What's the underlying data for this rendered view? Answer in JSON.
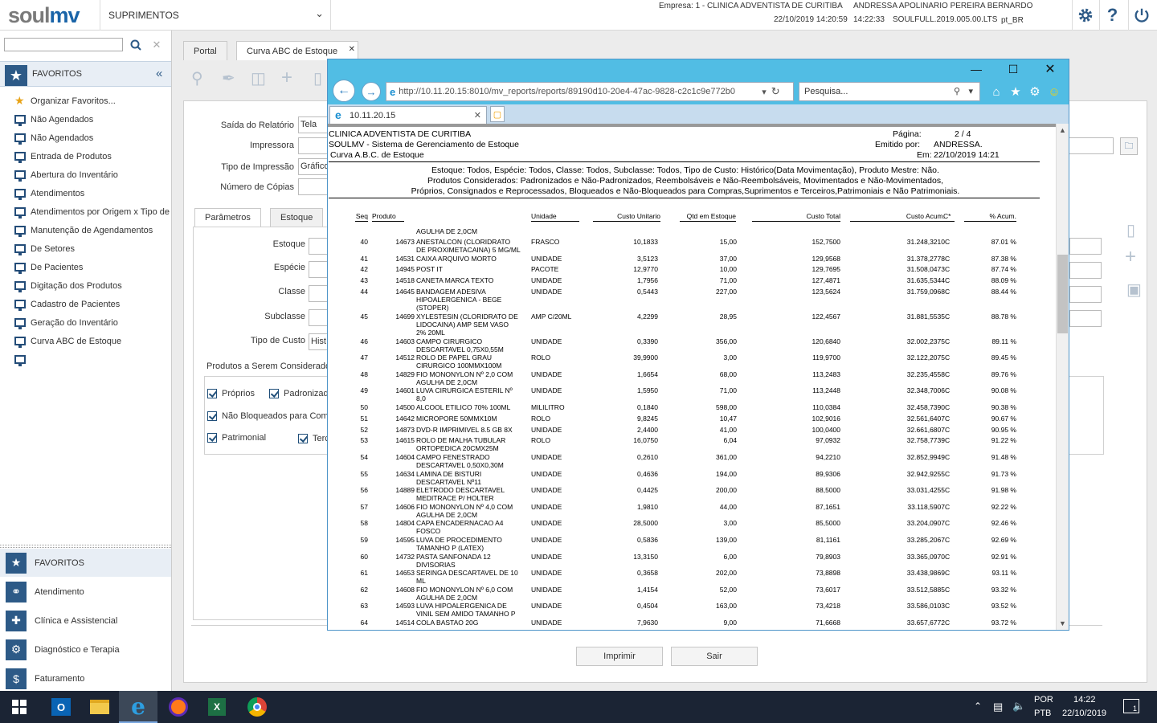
{
  "topbar": {
    "logo_main": "soul",
    "logo_accent": "mv",
    "module": "SUPRIMENTOS",
    "empresa": "Empresa: 1 - CLINICA ADVENTISTA DE CURITIBA",
    "user": "ANDRESSA APOLINARIO PEREIRA BERNARDO",
    "login_time": "22/10/2019 14:20:59",
    "clock": "14:22:33",
    "version": "SOULFULL.2019.005.00.LTS",
    "locale": "pt_BR",
    "icons": [
      "gear-icon",
      "help-icon",
      "power-icon"
    ]
  },
  "sidebar": {
    "search_placeholder": "",
    "favorites_title": "FAVORITOS",
    "items": [
      {
        "label": "Organizar Favoritos...",
        "icon": "star-icon"
      },
      {
        "label": "Não Agendados",
        "icon": "monitor-icon"
      },
      {
        "label": "Não Agendados",
        "icon": "monitor-icon"
      },
      {
        "label": "Entrada de Produtos",
        "icon": "monitor-icon"
      },
      {
        "label": "Abertura do Inventário",
        "icon": "monitor-icon"
      },
      {
        "label": "Atendimentos",
        "icon": "monitor-icon"
      },
      {
        "label": "Atendimentos por Origem x Tipo de",
        "icon": "monitor-icon"
      },
      {
        "label": "Manutenção de Agendamentos",
        "icon": "monitor-icon"
      },
      {
        "label": "De Setores",
        "icon": "monitor-icon"
      },
      {
        "label": "De Pacientes",
        "icon": "monitor-icon"
      },
      {
        "label": "Digitação dos Produtos",
        "icon": "monitor-icon"
      },
      {
        "label": "Cadastro de Pacientes",
        "icon": "monitor-icon"
      },
      {
        "label": "Geração do Inventário",
        "icon": "monitor-icon"
      },
      {
        "label": "Curva ABC de Estoque",
        "icon": "monitor-icon"
      },
      {
        "label": "",
        "icon": "monitor-icon"
      }
    ],
    "categories": [
      {
        "label": "FAVORITOS",
        "icon": "star-icon"
      },
      {
        "label": "Atendimento",
        "icon": "stethoscope-icon"
      },
      {
        "label": "Clínica e Assistencial",
        "icon": "medkit-icon"
      },
      {
        "label": "Diagnóstico e Terapia",
        "icon": "microscope-icon"
      },
      {
        "label": "Faturamento",
        "icon": "dollar-icon"
      }
    ]
  },
  "main": {
    "tabs": [
      {
        "label": "Portal"
      },
      {
        "label": "Curva ABC de Estoque",
        "close": "✕"
      }
    ],
    "form": {
      "saida_label": "Saída do Relatório",
      "saida_value": "Tela",
      "impressora_label": "Impressora",
      "impressora_value": "",
      "tipo_impressao_label": "Tipo de Impressão",
      "tipo_impressao_value": "Gráfico",
      "copias_label": "Número de Cópias",
      "copias_value": ""
    },
    "subtabs": [
      {
        "label": "Parâmetros"
      },
      {
        "label": "Estoque"
      }
    ],
    "params": {
      "estoque": "Estoque",
      "especie": "Espécie",
      "classe": "Classe",
      "subclasse": "Subclasse",
      "tipo_custo": "Tipo de Custo",
      "tipo_custo_value": "Hist",
      "produtos_title": "Produtos a Serem Considerados",
      "proprios": "Próprios",
      "padronizados": "Padronizad",
      "nao_bloqueados": "Não Bloqueados para Comp",
      "patrimonial": "Patrimonial",
      "terceiros": "Terc"
    },
    "buttons": {
      "imprimir": "Imprimir",
      "sair": "Sair"
    }
  },
  "browser": {
    "url": "http://10.11.20.15:8010/mv_reports/reports/89190d10-20e4-47ac-9828-c2c1c9e772b0",
    "url_host": "10.11.20.15",
    "search_placeholder": "Pesquisa...",
    "tab_title": "10.11.20.15"
  },
  "report": {
    "company": "CLINICA ADVENTISTA DE CURITIBA",
    "system": "SOULMV - Sistema de Gerenciamento de Estoque",
    "title": "Curva A.B.C. de Estoque",
    "page_label": "Página:",
    "page_value": "2 / 4",
    "emitido_label": "Emitido por:",
    "emitido_value": "ANDRESSA.",
    "em_label": "Em:",
    "em_value": "22/10/2019 14:21",
    "filter1": "Estoque: Todos, Espécie: Todos, Classe: Todos, Subclasse: Todos, Tipo de Custo: Histórico(Data Movimentação), Produto Mestre: Não.",
    "filter2": "Produtos Considerados: Padronizados e Não-Padronizados, Reembolsáveis e Não-Reembolsáveis, Movimentados e Não-Movimentados,",
    "filter3": "Próprios, Consignados e Reprocessados, Bloqueados e Não-Bloqueados para Compras,Suprimentos e Terceiros,Patrimoniais e Não Patrimoniais.",
    "columns": [
      "Seq",
      "Produto",
      "Unidade",
      "Custo Unitario",
      "Qtd em Estoque",
      "Custo Total",
      "Custo Acum.",
      "C*",
      "% Acum."
    ],
    "pre_line": "AGULHA DE 2,0CM",
    "rows": [
      {
        "seq": "40",
        "cod": "14673",
        "desc": [
          "ANESTALCON (CLORIDRATO",
          "DE PROXIMETACAINA) 5 MG/ML"
        ],
        "un": "FRASCO",
        "cu": "10,1833",
        "qtd": "15,00",
        "ct": "152,7500",
        "ca": "31.248,3210",
        "c": "C",
        "pa": "87.01 %"
      },
      {
        "seq": "41",
        "cod": "14531",
        "desc": [
          "CAIXA ARQUIVO MORTO"
        ],
        "un": "UNIDADE",
        "cu": "3,5123",
        "qtd": "37,00",
        "ct": "129,9568",
        "ca": "31.378,2778",
        "c": "C",
        "pa": "87.38 %"
      },
      {
        "seq": "42",
        "cod": "14945",
        "desc": [
          "POST IT"
        ],
        "un": "PACOTE",
        "cu": "12,9770",
        "qtd": "10,00",
        "ct": "129,7695",
        "ca": "31.508,0473",
        "c": "C",
        "pa": "87.74 %"
      },
      {
        "seq": "43",
        "cod": "14518",
        "desc": [
          "CANETA MARCA TEXTO"
        ],
        "un": "UNIDADE",
        "cu": "1,7956",
        "qtd": "71,00",
        "ct": "127,4871",
        "ca": "31.635,5344",
        "c": "C",
        "pa": "88.09 %"
      },
      {
        "seq": "44",
        "cod": "14645",
        "desc": [
          "BANDAGEM ADESIVA",
          "HIPOALERGENICA - BEGE",
          "(STOPER)"
        ],
        "un": "UNIDADE",
        "cu": "0,5443",
        "qtd": "227,00",
        "ct": "123,5624",
        "ca": "31.759,0968",
        "c": "C",
        "pa": "88.44 %"
      },
      {
        "seq": "45",
        "cod": "14699",
        "desc": [
          "XYLESTESIN (CLORIDRATO DE",
          "LIDOCAINA) AMP SEM VASO",
          "2% 20ML"
        ],
        "un": "AMP C/20ML",
        "cu": "4,2299",
        "qtd": "28,95",
        "ct": "122,4567",
        "ca": "31.881,5535",
        "c": "C",
        "pa": "88.78 %"
      },
      {
        "seq": "46",
        "cod": "14603",
        "desc": [
          "CAMPO CIRURGICO",
          "DESCARTAVEL 0,75X0,55M"
        ],
        "un": "UNIDADE",
        "cu": "0,3390",
        "qtd": "356,00",
        "ct": "120,6840",
        "ca": "32.002,2375",
        "c": "C",
        "pa": "89.11 %"
      },
      {
        "seq": "47",
        "cod": "14512",
        "desc": [
          "ROLO DE PAPEL GRAU",
          "CIRURGICO 100MMX100M"
        ],
        "un": "ROLO",
        "cu": "39,9900",
        "qtd": "3,00",
        "ct": "119,9700",
        "ca": "32.122,2075",
        "c": "C",
        "pa": "89.45 %"
      },
      {
        "seq": "48",
        "cod": "14829",
        "desc": [
          "FIO MONONYLON Nº 2,0 COM",
          "AGULHA DE 2,0CM"
        ],
        "un": "UNIDADE",
        "cu": "1,6654",
        "qtd": "68,00",
        "ct": "113,2483",
        "ca": "32.235,4558",
        "c": "C",
        "pa": "89.76 %"
      },
      {
        "seq": "49",
        "cod": "14601",
        "desc": [
          "LUVA CIRURGICA ESTERIL Nº",
          "8,0"
        ],
        "un": "UNIDADE",
        "cu": "1,5950",
        "qtd": "71,00",
        "ct": "113,2448",
        "ca": "32.348,7006",
        "c": "C",
        "pa": "90.08 %"
      },
      {
        "seq": "50",
        "cod": "14500",
        "desc": [
          "ALCOOL ETILICO 70% 100ML"
        ],
        "un": "MILILITRO",
        "cu": "0,1840",
        "qtd": "598,00",
        "ct": "110,0384",
        "ca": "32.458,7390",
        "c": "C",
        "pa": "90.38 %"
      },
      {
        "seq": "51",
        "cod": "14642",
        "desc": [
          "MICROPORE 50MMX10M"
        ],
        "un": "ROLO",
        "cu": "9,8245",
        "qtd": "10,47",
        "ct": "102,9016",
        "ca": "32.561,6407",
        "c": "C",
        "pa": "90.67 %"
      },
      {
        "seq": "52",
        "cod": "14873",
        "desc": [
          "DVD-R IMPRIMIVEL 8.5 GB 8X"
        ],
        "un": "UNIDADE",
        "cu": "2,4400",
        "qtd": "41,00",
        "ct": "100,0400",
        "ca": "32.661,6807",
        "c": "C",
        "pa": "90.95 %"
      },
      {
        "seq": "53",
        "cod": "14615",
        "desc": [
          "ROLO DE MALHA TUBULAR",
          "ORTOPEDICA 20CMX25M"
        ],
        "un": "ROLO",
        "cu": "16,0750",
        "qtd": "6,04",
        "ct": "97,0932",
        "ca": "32.758,7739",
        "c": "C",
        "pa": "91.22 %"
      },
      {
        "seq": "54",
        "cod": "14604",
        "desc": [
          "CAMPO FENESTRADO",
          "DESCARTAVEL 0,50X0,30M"
        ],
        "un": "UNIDADE",
        "cu": "0,2610",
        "qtd": "361,00",
        "ct": "94,2210",
        "ca": "32.852,9949",
        "c": "C",
        "pa": "91.48 %"
      },
      {
        "seq": "55",
        "cod": "14634",
        "desc": [
          "LAMINA DE BISTURI",
          "DESCARTAVEL Nº11"
        ],
        "un": "UNIDADE",
        "cu": "0,4636",
        "qtd": "194,00",
        "ct": "89,9306",
        "ca": "32.942,9255",
        "c": "C",
        "pa": "91.73 %"
      },
      {
        "seq": "56",
        "cod": "14889",
        "desc": [
          "ELETRODO DESCARTAVEL",
          "MEDITRACE P/ HOLTER"
        ],
        "un": "UNIDADE",
        "cu": "0,4425",
        "qtd": "200,00",
        "ct": "88,5000",
        "ca": "33.031,4255",
        "c": "C",
        "pa": "91.98 %"
      },
      {
        "seq": "57",
        "cod": "14606",
        "desc": [
          "FIO MONONYLON Nº 4,0 COM",
          "AGULHA DE 2,0CM"
        ],
        "un": "UNIDADE",
        "cu": "1,9810",
        "qtd": "44,00",
        "ct": "87,1651",
        "ca": "33.118,5907",
        "c": "C",
        "pa": "92.22 %"
      },
      {
        "seq": "58",
        "cod": "14804",
        "desc": [
          "CAPA ENCADERNACAO A4",
          "FOSCO"
        ],
        "un": "UNIDADE",
        "cu": "28,5000",
        "qtd": "3,00",
        "ct": "85,5000",
        "ca": "33.204,0907",
        "c": "C",
        "pa": "92.46 %"
      },
      {
        "seq": "59",
        "cod": "14595",
        "desc": [
          "LUVA DE PROCEDIMENTO",
          "TAMANHO P (LATEX)"
        ],
        "un": "UNIDADE",
        "cu": "0,5836",
        "qtd": "139,00",
        "ct": "81,1161",
        "ca": "33.285,2067",
        "c": "C",
        "pa": "92.69 %"
      },
      {
        "seq": "60",
        "cod": "14732",
        "desc": [
          "PASTA SANFONADA 12",
          "DIVISORIAS"
        ],
        "un": "UNIDADE",
        "cu": "13,3150",
        "qtd": "6,00",
        "ct": "79,8903",
        "ca": "33.365,0970",
        "c": "C",
        "pa": "92.91 %"
      },
      {
        "seq": "61",
        "cod": "14653",
        "desc": [
          "SERINGA DESCARTAVEL DE 10",
          "ML"
        ],
        "un": "UNIDADE",
        "cu": "0,3658",
        "qtd": "202,00",
        "ct": "73,8898",
        "ca": "33.438,9869",
        "c": "C",
        "pa": "93.11 %"
      },
      {
        "seq": "62",
        "cod": "14608",
        "desc": [
          "FIO MONONYLON Nº 6,0 COM",
          "AGULHA DE 2,0CM"
        ],
        "un": "UNIDADE",
        "cu": "1,4154",
        "qtd": "52,00",
        "ct": "73,6017",
        "ca": "33.512,5885",
        "c": "C",
        "pa": "93.32 %"
      },
      {
        "seq": "63",
        "cod": "14593",
        "desc": [
          "LUVA HIPOALERGENICA DE",
          "VINIL SEM AMIDO TAMANHO P"
        ],
        "un": "UNIDADE",
        "cu": "0,4504",
        "qtd": "163,00",
        "ct": "73,4218",
        "ca": "33.586,0103",
        "c": "C",
        "pa": "93.52 %"
      },
      {
        "seq": "64",
        "cod": "14514",
        "desc": [
          "COLA BASTAO 20G"
        ],
        "un": "UNIDADE",
        "cu": "7,9630",
        "qtd": "9,00",
        "ct": "71,6668",
        "ca": "33.657,6772",
        "c": "C",
        "pa": "93.72 %"
      }
    ]
  },
  "taskbar": {
    "lang1": "POR",
    "lang2": "PTB",
    "time": "14:22",
    "date": "22/10/2019",
    "notif_count": "1",
    "apps": [
      "windows-icon",
      "outlook-icon",
      "file-explorer-icon",
      "ie-icon",
      "firefox-icon",
      "excel-icon",
      "chrome-icon"
    ]
  }
}
